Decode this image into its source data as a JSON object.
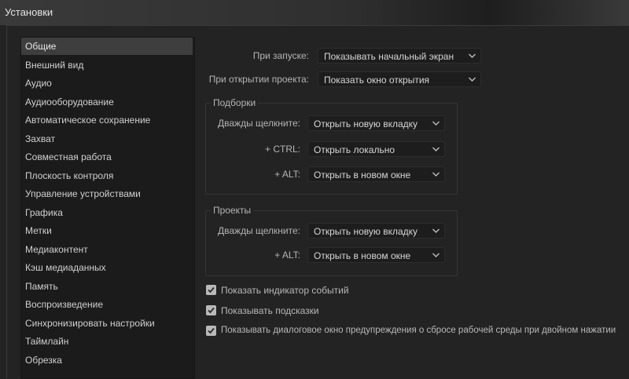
{
  "window": {
    "title": "Установки"
  },
  "sidebar": {
    "items": [
      {
        "label": "Общие"
      },
      {
        "label": "Внешний вид"
      },
      {
        "label": "Аудио"
      },
      {
        "label": "Аудиооборудование"
      },
      {
        "label": "Автоматическое сохранение"
      },
      {
        "label": "Захват"
      },
      {
        "label": "Совместная работа"
      },
      {
        "label": "Плоскость контроля"
      },
      {
        "label": "Управление устройствами"
      },
      {
        "label": "Графика"
      },
      {
        "label": "Метки"
      },
      {
        "label": "Медиаконтент"
      },
      {
        "label": "Кэш медиаданных"
      },
      {
        "label": "Память"
      },
      {
        "label": "Воспроизведение"
      },
      {
        "label": "Синхронизировать настройки"
      },
      {
        "label": "Таймлайн"
      },
      {
        "label": "Обрезка"
      }
    ],
    "selected": "Общие"
  },
  "startup": {
    "label": "При запуске:",
    "value": "Показывать начальный экран"
  },
  "project_open": {
    "label": "При открытии проекта:",
    "value": "Показать окно открытия"
  },
  "bins": {
    "title": "Подборки",
    "double_click": {
      "label": "Дважды щелкните:",
      "value": "Открыть новую вкладку"
    },
    "ctrl": {
      "label": "+ CTRL:",
      "value": "Открыть локально"
    },
    "alt": {
      "label": "+ ALT:",
      "value": "Открыть в новом окне"
    }
  },
  "projects": {
    "title": "Проекты",
    "double_click": {
      "label": "Дважды щелкните:",
      "value": "Открыть новую вкладку"
    },
    "alt": {
      "label": "+ ALT:",
      "value": "Открыть в новом окне"
    }
  },
  "checkboxes": [
    {
      "label": "Показать индикатор событий",
      "checked": true
    },
    {
      "label": "Показывать подсказки",
      "checked": true
    },
    {
      "label": "Показывать диалоговое окно предупреждения о сбросе рабочей среды при двойном нажатии",
      "checked": true
    }
  ],
  "colors": {
    "selected_item": "#3e3e3e",
    "panel": "#232323",
    "sidebar": "#1b1b1b"
  }
}
